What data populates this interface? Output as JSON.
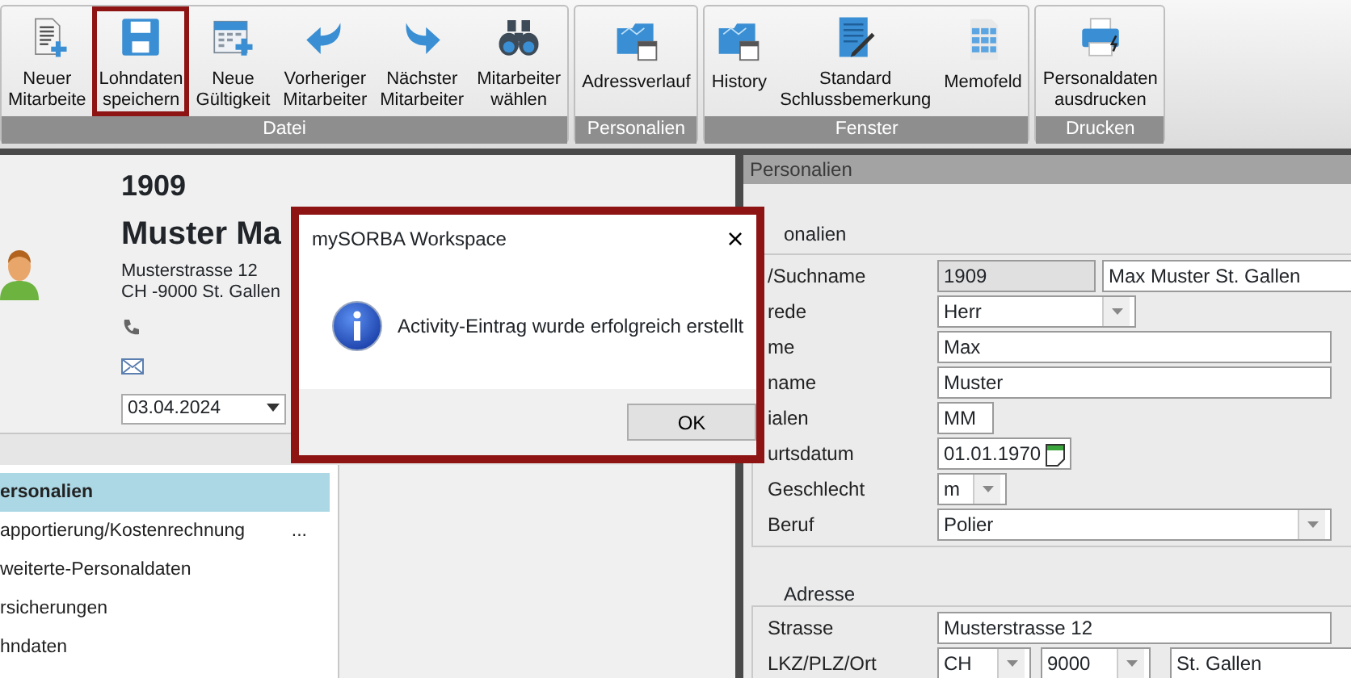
{
  "ribbon": {
    "groups": [
      {
        "label": "Datei",
        "buttons": [
          {
            "lines": [
              "Neuer",
              "Mitarbeite"
            ],
            "highlighted": false
          },
          {
            "lines": [
              "Lohndaten",
              "speichern"
            ],
            "highlighted": true
          },
          {
            "lines": [
              "Neue",
              "Gültigkeit"
            ],
            "highlighted": false
          },
          {
            "lines": [
              "Vorheriger",
              "Mitarbeiter"
            ],
            "highlighted": false
          },
          {
            "lines": [
              "Nächster",
              "Mitarbeiter"
            ],
            "highlighted": false
          },
          {
            "lines": [
              "Mitarbeiter",
              "wählen"
            ],
            "highlighted": false
          }
        ]
      },
      {
        "label": "Personalien",
        "buttons": [
          {
            "lines": [
              "Adressverlauf"
            ],
            "highlighted": false
          }
        ]
      },
      {
        "label": "Fenster",
        "buttons": [
          {
            "lines": [
              "History"
            ],
            "highlighted": false
          },
          {
            "lines": [
              "Standard",
              "Schlussbemerkung"
            ],
            "highlighted": false
          },
          {
            "lines": [
              "Memofeld"
            ],
            "highlighted": false
          }
        ]
      },
      {
        "label": "Drucken",
        "buttons": [
          {
            "lines": [
              "Personaldaten",
              "ausdrucken"
            ],
            "highlighted": false
          }
        ]
      }
    ]
  },
  "employee": {
    "number": "1909",
    "name": "Muster Ma",
    "address_lines": [
      "Musterstrasse 12",
      "CH -9000 St. Gallen"
    ],
    "date": "03.04.2024"
  },
  "nav_items": [
    {
      "label": "ersonalien",
      "selected": true
    },
    {
      "label": "apportierung/Kostenrechnung",
      "selected": false,
      "trailing": "..."
    },
    {
      "label": "weiterte-Personaldaten",
      "selected": false
    },
    {
      "label": "rsicherungen",
      "selected": false
    },
    {
      "label": "hndaten",
      "selected": false
    }
  ],
  "detail": {
    "title": "Personalien",
    "sections": [
      {
        "title": "onalien",
        "rows": [
          {
            "label": "/Suchname",
            "fields": [
              {
                "kind": "readonly",
                "value": "1909"
              },
              {
                "kind": "text",
                "value": "Max Muster St. Gallen"
              }
            ]
          },
          {
            "label": "rede",
            "fields": [
              {
                "kind": "select",
                "value": "Herr"
              }
            ]
          },
          {
            "label": "me",
            "fields": [
              {
                "kind": "text",
                "value": "Max"
              }
            ]
          },
          {
            "label": "name",
            "fields": [
              {
                "kind": "text",
                "value": "Muster"
              }
            ]
          },
          {
            "label": "ialen",
            "fields": [
              {
                "kind": "text",
                "value": "MM"
              }
            ]
          },
          {
            "label": "urtsdatum",
            "fields": [
              {
                "kind": "date",
                "value": "01.01.1970"
              }
            ]
          },
          {
            "label": "Geschlecht",
            "fields": [
              {
                "kind": "select",
                "value": "m"
              }
            ]
          },
          {
            "label": "Beruf",
            "fields": [
              {
                "kind": "select",
                "value": "Polier"
              }
            ]
          }
        ]
      },
      {
        "title": "Adresse",
        "rows": [
          {
            "label": "Strasse",
            "fields": [
              {
                "kind": "text",
                "value": "Musterstrasse 12"
              }
            ]
          },
          {
            "label": "LKZ/PLZ/Ort",
            "fields": [
              {
                "kind": "select",
                "value": "CH"
              },
              {
                "kind": "select",
                "value": "9000"
              },
              {
                "kind": "text",
                "value": "St. Gallen"
              }
            ]
          }
        ]
      }
    ]
  },
  "dialog": {
    "title": "mySORBA Workspace",
    "close": "×",
    "message": "Activity-Eintrag wurde erfolgreich erstellt",
    "buttons": [
      "OK"
    ]
  }
}
